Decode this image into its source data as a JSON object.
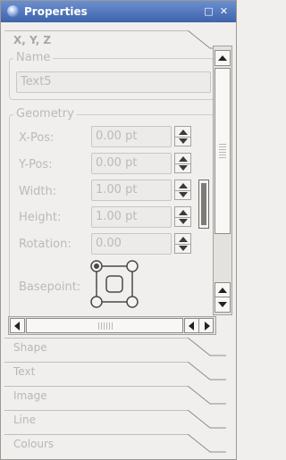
{
  "window": {
    "title": "Properties",
    "minimize_glyph": "□",
    "close_glyph": "✕"
  },
  "tabs_top": {
    "active_label": "X, Y, Z"
  },
  "name_group": {
    "title": "Name",
    "value": "Text5"
  },
  "geometry": {
    "title": "Geometry",
    "fields": [
      {
        "label": "X-Pos:",
        "value": "0.00 pt"
      },
      {
        "label": "Y-Pos:",
        "value": "0.00 pt"
      },
      {
        "label": "Width:",
        "value": "1.00 pt"
      },
      {
        "label": "Height:",
        "value": "1.00 pt"
      },
      {
        "label": "Rotation:",
        "value": "0.00"
      }
    ],
    "basepoint_label": "Basepoint:"
  },
  "tabs_bottom": [
    {
      "label": "Shape"
    },
    {
      "label": "Text"
    },
    {
      "label": "Image"
    },
    {
      "label": "Line"
    },
    {
      "label": "Colours"
    }
  ],
  "icons": {
    "app": "properties-app-icon",
    "minimize": "minimize-icon",
    "close": "close-icon",
    "link": "chain-link-icon",
    "basepoint": "basepoint-selector-icon"
  },
  "colors": {
    "titlebar": "#3f63aa",
    "background": "#f0efed",
    "disabled_text": "#bcbab6"
  }
}
